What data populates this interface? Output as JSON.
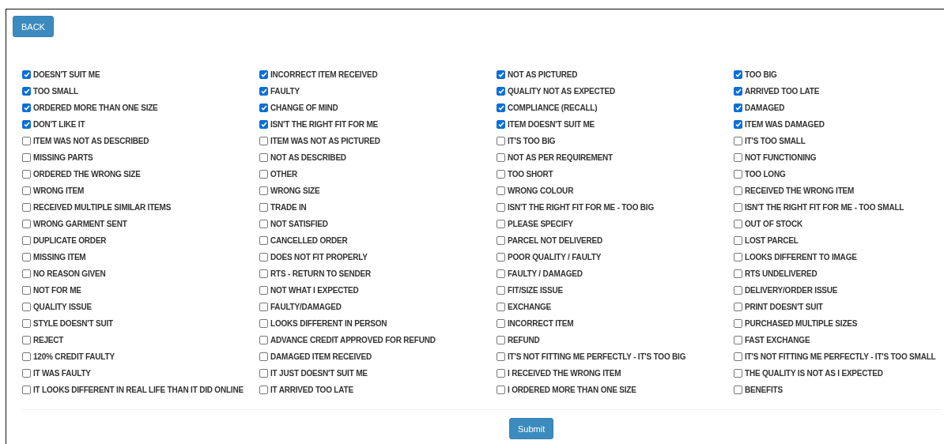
{
  "back_button": "BACK",
  "options": [
    {
      "label": "DOESN'T SUIT ME",
      "checked": true
    },
    {
      "label": "INCORRECT ITEM RECEIVED",
      "checked": true
    },
    {
      "label": "NOT AS PICTURED",
      "checked": true
    },
    {
      "label": "TOO BIG",
      "checked": true
    },
    {
      "label": "TOO SMALL",
      "checked": true
    },
    {
      "label": "FAULTY",
      "checked": true
    },
    {
      "label": "QUALITY NOT AS EXPECTED",
      "checked": true
    },
    {
      "label": "ARRIVED TOO LATE",
      "checked": true
    },
    {
      "label": "ORDERED MORE THAN ONE SIZE",
      "checked": true
    },
    {
      "label": "CHANGE OF MIND",
      "checked": true
    },
    {
      "label": "COMPLIANCE (RECALL)",
      "checked": true
    },
    {
      "label": "DAMAGED",
      "checked": true
    },
    {
      "label": "DON'T LIKE IT",
      "checked": true
    },
    {
      "label": "ISN'T THE RIGHT FIT FOR ME",
      "checked": true
    },
    {
      "label": "ITEM DOESN'T SUIT ME",
      "checked": true
    },
    {
      "label": "ITEM WAS DAMAGED",
      "checked": true
    },
    {
      "label": "ITEM WAS NOT AS DESCRIBED",
      "checked": false
    },
    {
      "label": "ITEM WAS NOT AS PICTURED",
      "checked": false
    },
    {
      "label": "IT'S TOO BIG",
      "checked": false
    },
    {
      "label": "IT'S TOO SMALL",
      "checked": false
    },
    {
      "label": "MISSING PARTS",
      "checked": false
    },
    {
      "label": "NOT AS DESCRIBED",
      "checked": false
    },
    {
      "label": "NOT AS PER REQUIREMENT",
      "checked": false
    },
    {
      "label": "NOT FUNCTIONING",
      "checked": false
    },
    {
      "label": "ORDERED THE WRONG SIZE",
      "checked": false
    },
    {
      "label": "OTHER",
      "checked": false
    },
    {
      "label": "TOO SHORT",
      "checked": false
    },
    {
      "label": "TOO LONG",
      "checked": false
    },
    {
      "label": "WRONG ITEM",
      "checked": false
    },
    {
      "label": "WRONG SIZE",
      "checked": false
    },
    {
      "label": "WRONG COLOUR",
      "checked": false
    },
    {
      "label": "RECEIVED THE WRONG ITEM",
      "checked": false
    },
    {
      "label": "RECEIVED MULTIPLE SIMILAR ITEMS",
      "checked": false
    },
    {
      "label": "TRADE IN",
      "checked": false
    },
    {
      "label": "ISN'T THE RIGHT FIT FOR ME - TOO BIG",
      "checked": false
    },
    {
      "label": "ISN'T THE RIGHT FIT FOR ME - TOO SMALL",
      "checked": false
    },
    {
      "label": "WRONG GARMENT SENT",
      "checked": false
    },
    {
      "label": "NOT SATISFIED",
      "checked": false
    },
    {
      "label": "PLEASE SPECIFY",
      "checked": false
    },
    {
      "label": "OUT OF STOCK",
      "checked": false
    },
    {
      "label": "DUPLICATE ORDER",
      "checked": false
    },
    {
      "label": "CANCELLED ORDER",
      "checked": false
    },
    {
      "label": "PARCEL NOT DELIVERED",
      "checked": false
    },
    {
      "label": "LOST PARCEL",
      "checked": false
    },
    {
      "label": "MISSING ITEM",
      "checked": false
    },
    {
      "label": "DOES NOT FIT PROPERLY",
      "checked": false
    },
    {
      "label": "POOR QUALITY / FAULTY",
      "checked": false
    },
    {
      "label": "LOOKS DIFFERENT TO IMAGE",
      "checked": false
    },
    {
      "label": "NO REASON GIVEN",
      "checked": false
    },
    {
      "label": "RTS - RETURN TO SENDER",
      "checked": false
    },
    {
      "label": "FAULTY / DAMAGED",
      "checked": false
    },
    {
      "label": "RTS UNDELIVERED",
      "checked": false
    },
    {
      "label": "NOT FOR ME",
      "checked": false
    },
    {
      "label": "NOT WHAT I EXPECTED",
      "checked": false
    },
    {
      "label": "FIT/SIZE ISSUE",
      "checked": false
    },
    {
      "label": "DELIVERY/ORDER ISSUE",
      "checked": false
    },
    {
      "label": "QUALITY ISSUE",
      "checked": false
    },
    {
      "label": "FAULTY/DAMAGED",
      "checked": false
    },
    {
      "label": "EXCHANGE",
      "checked": false
    },
    {
      "label": "PRINT DOESN'T SUIT",
      "checked": false
    },
    {
      "label": "STYLE DOESN'T SUIT",
      "checked": false
    },
    {
      "label": "LOOKS DIFFERENT IN PERSON",
      "checked": false
    },
    {
      "label": "INCORRECT ITEM",
      "checked": false
    },
    {
      "label": "PURCHASED MULTIPLE SIZES",
      "checked": false
    },
    {
      "label": "REJECT",
      "checked": false
    },
    {
      "label": "ADVANCE CREDIT APPROVED FOR REFUND",
      "checked": false
    },
    {
      "label": "REFUND",
      "checked": false
    },
    {
      "label": "FAST EXCHANGE",
      "checked": false
    },
    {
      "label": "120% CREDIT FAULTY",
      "checked": false
    },
    {
      "label": "DAMAGED ITEM RECEIVED",
      "checked": false
    },
    {
      "label": "IT'S NOT FITTING ME PERFECTLY - IT'S TOO BIG",
      "checked": false
    },
    {
      "label": "IT'S NOT FITTING ME PERFECTLY - IT'S TOO SMALL",
      "checked": false
    },
    {
      "label": "IT WAS FAULTY",
      "checked": false
    },
    {
      "label": "IT JUST DOESN'T SUIT ME",
      "checked": false
    },
    {
      "label": "I RECEIVED THE WRONG ITEM",
      "checked": false
    },
    {
      "label": "THE QUALITY IS NOT AS I EXPECTED",
      "checked": false
    },
    {
      "label": "IT LOOKS DIFFERENT IN REAL LIFE THAN IT DID ONLINE",
      "checked": false
    },
    {
      "label": "IT ARRIVED TOO LATE",
      "checked": false
    },
    {
      "label": "I ORDERED MORE THAN ONE SIZE",
      "checked": false
    },
    {
      "label": "BENEFITS",
      "checked": false
    }
  ],
  "submit_button": "Submit"
}
